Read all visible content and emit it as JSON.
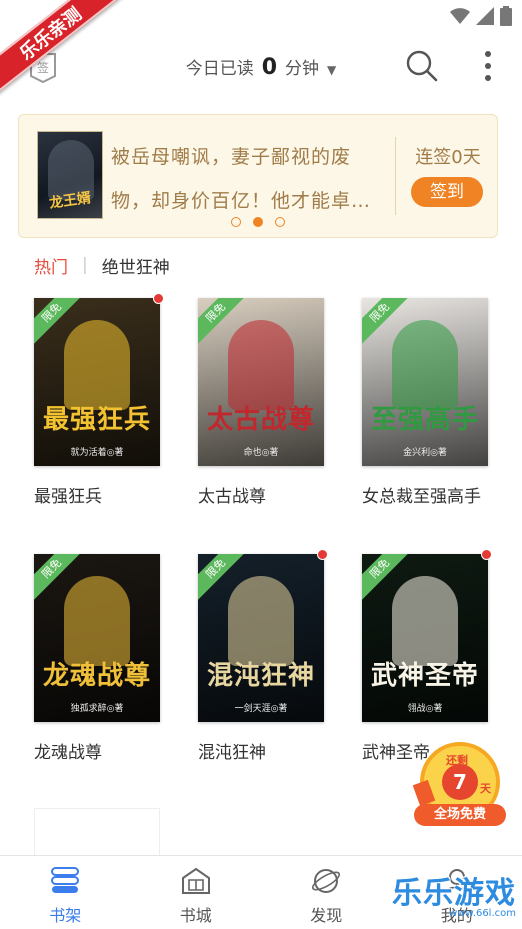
{
  "corner_ribbon": {
    "text": "乐乐亲测"
  },
  "header": {
    "today_read_prefix": "今日已读",
    "today_read_minutes": "0",
    "today_read_unit": "分钟",
    "caret": "▼"
  },
  "banner": {
    "cover_title": "龙王婿",
    "text": "被岳母嘲讽，妻子鄙视的废物，却身价百亿！他才能卓…",
    "streak_label": "连签0天",
    "signin_label": "签到",
    "page_count": 3,
    "active_page": 1
  },
  "categories": {
    "hot_label": "热门",
    "separator": "|",
    "current": "绝世狂神"
  },
  "free_tag": "限免",
  "books": [
    {
      "title": "最强狂兵",
      "cover_text": "最强狂兵",
      "author": "就为活着◎著",
      "free": true,
      "unread": true,
      "bg": "#3b2f1c",
      "accent": "#f2c230"
    },
    {
      "title": "太古战尊",
      "cover_text": "太古战尊",
      "author": "命也◎著",
      "free": true,
      "unread": false,
      "bg": "#d9cfc0",
      "accent": "#c1272d"
    },
    {
      "title": "女总裁至强高手",
      "cover_text": "至强高手",
      "author": "金兴利◎著",
      "free": true,
      "unread": false,
      "bg": "#e9e6e2",
      "accent": "#2f9a3f"
    },
    {
      "title": "龙魂战尊",
      "cover_text": "龙魂战尊",
      "author": "独孤求醉◎著",
      "free": true,
      "unread": false,
      "bg": "#1b1712",
      "accent": "#f0c038"
    },
    {
      "title": "混沌狂神",
      "cover_text": "混沌狂神",
      "author": "一剑天涯◎著",
      "free": true,
      "unread": true,
      "bg": "#14202a",
      "accent": "#e8d6a0"
    },
    {
      "title": "武神圣帝",
      "cover_text": "武神圣帝",
      "author": "翎战◎著",
      "free": true,
      "unread": true,
      "bg": "#0e1a12",
      "accent": "#f7f3e6"
    }
  ],
  "promo": {
    "remain": "还剩",
    "days": "7",
    "unit": "天",
    "label": "全场免费"
  },
  "bottom_nav": [
    {
      "label": "书架",
      "icon": "bookshelf-icon",
      "active": true
    },
    {
      "label": "书城",
      "icon": "book-city-icon",
      "active": false
    },
    {
      "label": "发现",
      "icon": "discover-planet-icon",
      "active": false
    },
    {
      "label": "我的",
      "icon": "profile-icon",
      "active": false
    }
  ],
  "watermark": {
    "text": "乐乐游戏",
    "url": "www.66l.com"
  },
  "colors": {
    "accent": "#3b7ded",
    "orange": "#f08424",
    "hot": "#e74c3c",
    "free_green": "#5cb85c"
  }
}
